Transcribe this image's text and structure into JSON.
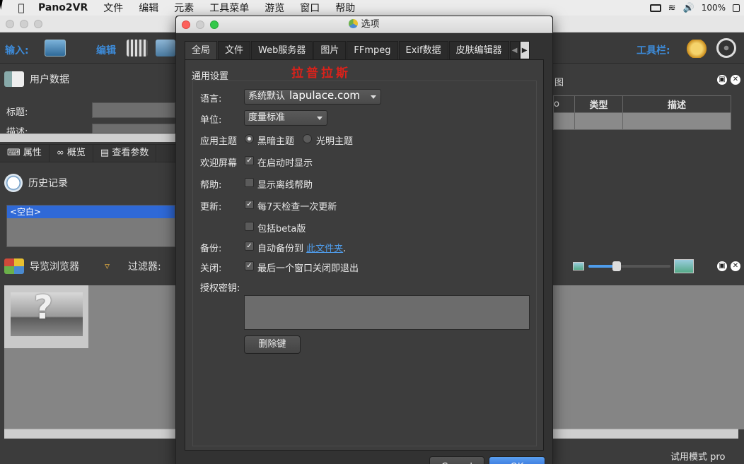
{
  "menubar": {
    "apple": "",
    "app_name": "Pano2VR",
    "items": [
      "文件",
      "编辑",
      "元素",
      "工具菜单",
      "游览",
      "窗口",
      "帮助"
    ],
    "battery": "100%"
  },
  "toolbar": {
    "input_label": "输入:",
    "edit_label": "编辑",
    "tools_label": "工具栏:"
  },
  "user_data": {
    "title": "用户数据",
    "title_label": "标题:",
    "desc_label": "描述:"
  },
  "left_tabs": [
    "属性",
    "概览",
    "查看参数"
  ],
  "history": {
    "title": "历史记录",
    "selected": "<空白>"
  },
  "browser": {
    "title": "导览浏览器",
    "filter_label": "过滤器:",
    "thumb_symbol": "?"
  },
  "right_panel": {
    "title_fragment": "图",
    "col_fragment": "o",
    "col_type": "类型",
    "col_desc": "描述"
  },
  "status": {
    "trial": "试用模式 pro"
  },
  "dialog": {
    "title": "选项",
    "tabs": [
      "全局",
      "文件",
      "Web服务器",
      "图片",
      "FFmpeg",
      "Exif数据",
      "皮肤编辑器"
    ],
    "active_tab": "全局",
    "section_title": "通用设置",
    "watermark_cn": "拉普拉斯",
    "watermark_url": "lapulace.com",
    "language_label": "语言:",
    "language_value": "系统默认",
    "units_label": "单位:",
    "units_value": "度量标准",
    "theme_label": "应用主题",
    "theme_dark": "黑暗主题",
    "theme_light": "光明主题",
    "welcome_label": "欢迎屏幕",
    "welcome_cb": "在启动时显示",
    "help_label": "帮助:",
    "help_cb": "显示离线帮助",
    "update_label": "更新:",
    "update_cb": "每7天检查一次更新",
    "beta_cb": "包括beta版",
    "backup_label": "备份:",
    "backup_cb": "自动备份到",
    "backup_link": "此文件夹",
    "backup_dot": ".",
    "close_label": "关闭:",
    "close_cb": "最后一个窗口关闭即退出",
    "license_label": "授权密钥:",
    "delete_key": "删除键",
    "cancel": "Cancel",
    "ok": "OK"
  },
  "colors": {
    "accent": "#3d8bd9",
    "selection": "#2f69d7",
    "link": "#4f9dec",
    "watermark": "#d8221b"
  }
}
